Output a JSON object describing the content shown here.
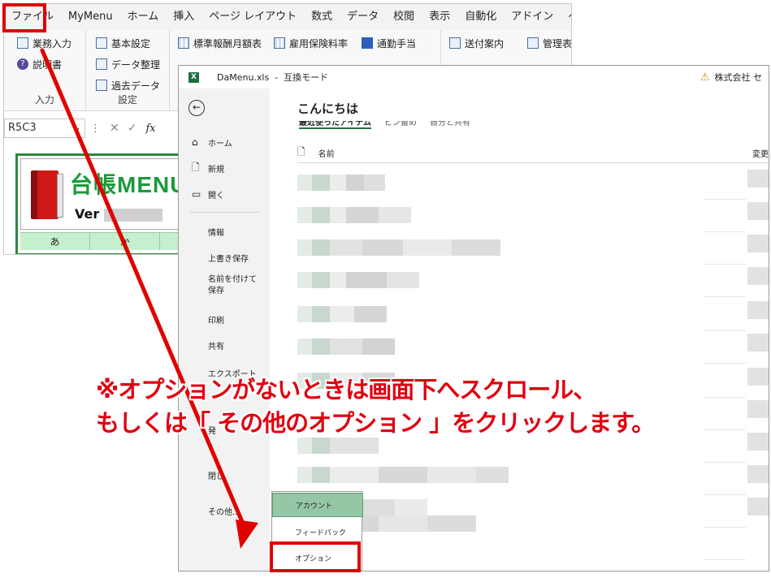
{
  "menubar": {
    "tabs": [
      "ファイル",
      "MyMenu",
      "ホーム",
      "挿入",
      "ページ レイアウト",
      "数式",
      "データ",
      "校閲",
      "表示",
      "自動化",
      "アドイン",
      "ヘルプ"
    ]
  },
  "ribbon": {
    "group_input": {
      "name": "入力",
      "items": [
        "業務入力",
        "説明書"
      ]
    },
    "group_settings": {
      "name": "設定",
      "items": [
        "基本設定",
        "データ整理",
        "過去データ"
      ]
    },
    "group_tables": {
      "items": [
        "標準報酬月額表",
        "雇用保険料率",
        "通勤手当"
      ]
    },
    "group_docs": {
      "items": [
        "送付案内",
        "管理表"
      ]
    }
  },
  "formula_bar": {
    "name_box": "R5C3",
    "fx": "fx"
  },
  "sheet": {
    "banner_title": "台帳MENU",
    "version_label": "Ver",
    "col_headers": [
      "あ",
      "か"
    ]
  },
  "backstage": {
    "title": "DaMenu.xls  -  互換モード",
    "warning_text": "株式会社 セ",
    "nav": {
      "home": "ホーム",
      "new": "新規",
      "open": "開く",
      "info": "情報",
      "save": "上書き保存",
      "save_as": "名前を付けて保存",
      "print": "印刷",
      "share": "共有",
      "export": "エクスポート",
      "publish": "発",
      "close": "閉じ",
      "more": "その他..."
    },
    "greeting": "こんにちは",
    "tabs": [
      "最近使ったアイテム",
      "ピン留め",
      "自分と共有"
    ],
    "file_header": {
      "name": "名前",
      "modified": "変更"
    }
  },
  "more_popup": {
    "account": "アカウント",
    "feedback": "フィードバック",
    "options": "オプション"
  },
  "callout": {
    "line1": "※オプションがないときは画面下へスクロール、",
    "line2": "もしくは「 その他のオプション 」をクリックします。"
  },
  "colors": {
    "annotation_red": "#e00000",
    "excel_green": "#217346",
    "banner_green": "#1a9a3a"
  }
}
